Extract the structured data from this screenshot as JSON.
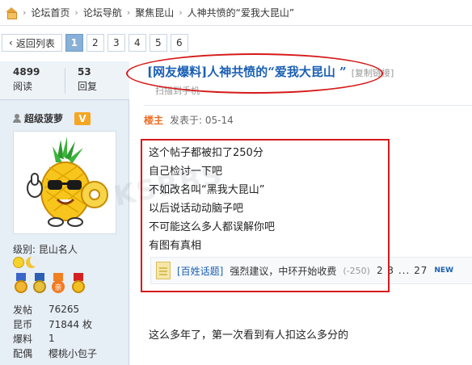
{
  "breadcrumb": {
    "items": [
      "论坛首页",
      "论坛导航",
      "聚焦昆山",
      "人神共愤的“爱我大昆山”"
    ]
  },
  "pager": {
    "back_label": "返回列表",
    "pages": [
      "1",
      "2",
      "3",
      "4",
      "5",
      "6"
    ],
    "current": "1"
  },
  "thread_stats": {
    "views": "4899",
    "views_label": "阅读",
    "replies": "53",
    "replies_label": "回复"
  },
  "thread": {
    "title": "[网友爆料]人神共愤的“爱我大昆山 ”",
    "copy_link": "[复制链接]",
    "scan_text": "扫描到手机"
  },
  "author": {
    "name": "超级菠萝",
    "vip_badge": "V",
    "level": "级别: 昆山名人",
    "medal_text": "亲",
    "info": [
      {
        "key": "发帖",
        "value": "76265"
      },
      {
        "key": "昆币",
        "value": "71844 枚"
      },
      {
        "key": "爆料",
        "value": "1"
      },
      {
        "key": "配偶",
        "value": "樱桃小包子"
      }
    ]
  },
  "post": {
    "owner_label": "楼主",
    "date": "发表于: 05-14",
    "lines": [
      "这个帖子都被扣了250分",
      "自己检讨一下吧",
      "不如改名叫“黑我大昆山”",
      "以后说话动动脑子吧",
      "不可能这么多人都误解你吧",
      "有图有真相"
    ],
    "related": {
      "category": "[百姓话题]",
      "title": "强烈建议，中环开始收费",
      "count": "(-250)",
      "pages": "2 3 ... 27",
      "new_badge": "NEW"
    }
  },
  "reply": {
    "text": "这么多年了，第一次看到有人扣这么多分的"
  },
  "watermark": "KSBBS",
  "colors": {
    "accent": "#1a5fb4",
    "highlight": "#d61a1a",
    "owner": "#f26c22",
    "sidebar_bg": "#e6eef6"
  }
}
